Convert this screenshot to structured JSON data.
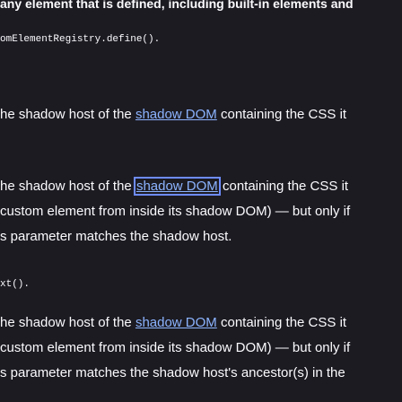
{
  "top_text": "any element that is defined, including built-in elements and",
  "code_line_1": "omElementRegistry.define().",
  "para1": {
    "pre": "he shadow host of the ",
    "link": "shadow DOM",
    "post": " containing the CSS it"
  },
  "para2": {
    "line1_pre": "he shadow host of the ",
    "line1_link": "shadow DOM",
    "line1_post": " containing the CSS it",
    "line2": "custom element from inside its shadow DOM) — but only if",
    "line3": "s parameter matches the shadow host."
  },
  "code_line_2": "xt().",
  "para3": {
    "line1_pre": "he shadow host of the ",
    "line1_link": "shadow DOM",
    "line1_post": " containing the CSS it",
    "line2": "custom element from inside its shadow DOM) — but only if",
    "line3": "s parameter matches the shadow host's ancestor(s) in the"
  }
}
